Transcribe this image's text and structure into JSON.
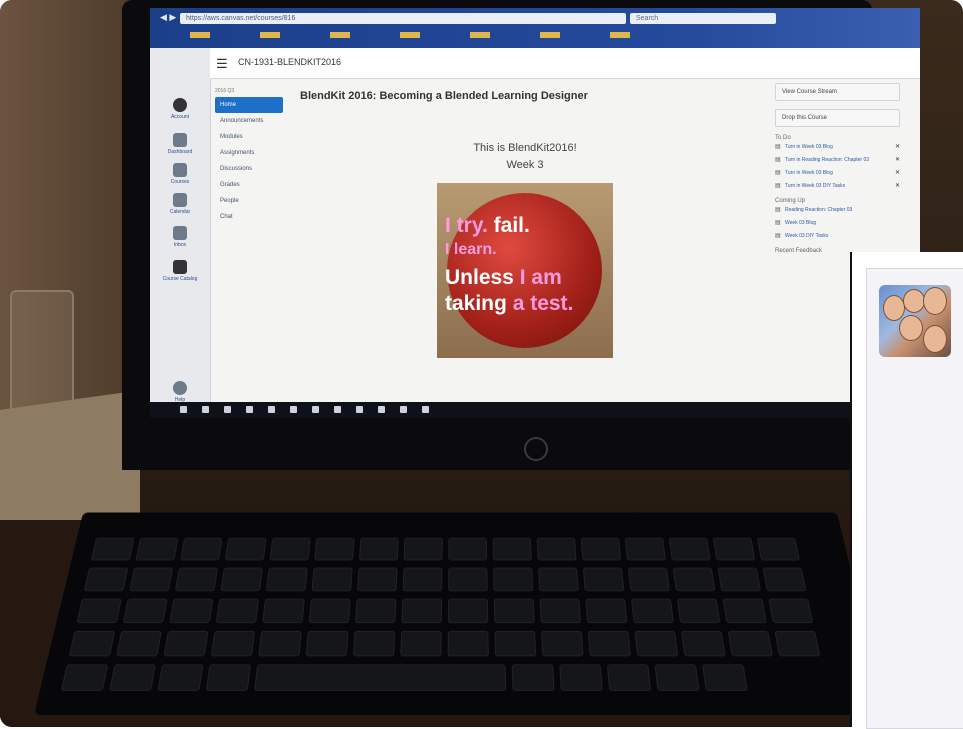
{
  "browser": {
    "url": "https://aws.canvas.net/courses/816",
    "search_placeholder": "Search"
  },
  "canvas_nav": {
    "items": [
      "Account",
      "Dashboard",
      "Courses",
      "Calendar",
      "Inbox",
      "Course Catalog",
      "Help"
    ]
  },
  "course": {
    "breadcrumb": "CN-1931-BLENDKIT2016",
    "title": "BlendKit 2016: Becoming a Blended Learning Designer",
    "nav_header": "2016 Q3",
    "nav": [
      "Home",
      "Announcements",
      "Modules",
      "Assignments",
      "Discussions",
      "Grades",
      "People",
      "Chat"
    ]
  },
  "content": {
    "line1": "This is BlendKit2016!",
    "line2": "Week 3",
    "image_text": {
      "l1a": "I try.",
      "l1b": "fail.",
      "l2": "I learn.",
      "l3a": "Unless",
      "l3b": "I am",
      "l4a": "taking",
      "l4b": "a test."
    }
  },
  "sidebar": {
    "view_stream": "View Course Stream",
    "drop_course": "Drop this Course",
    "todo_header": "To Do",
    "todo": [
      "Turn in Week 03 Blog",
      "Turn in Reading Reaction: Chapter 03",
      "Turn in Week 03 Blog",
      "Turn in Week 03 DIY Tasks"
    ],
    "coming_header": "Coming Up",
    "coming": [
      "Reading Reaction: Chapter 03",
      "Week 03 Blog",
      "Week 03 DIY Tasks"
    ],
    "feedback_header": "Recent Feedback"
  }
}
